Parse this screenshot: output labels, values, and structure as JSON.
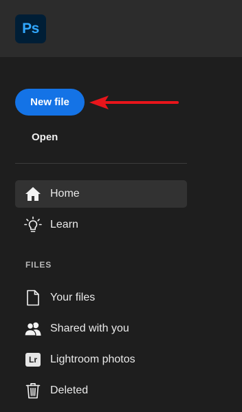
{
  "app": {
    "logo_text": "Ps",
    "logo_bg": "#001e36",
    "logo_fg": "#31a8ff"
  },
  "actions": {
    "new_file_label": "New file",
    "open_label": "Open",
    "accent_color": "#1473e6",
    "annotation_arrow_color": "#e8151b"
  },
  "nav": {
    "items": [
      {
        "label": "Home",
        "icon": "home-icon",
        "active": true
      },
      {
        "label": "Learn",
        "icon": "lightbulb-icon",
        "active": false
      }
    ]
  },
  "files": {
    "section_label": "FILES",
    "items": [
      {
        "label": "Your files",
        "icon": "document-icon"
      },
      {
        "label": "Shared with you",
        "icon": "users-icon"
      },
      {
        "label": "Lightroom photos",
        "icon": "lightroom-icon",
        "badge": "Lr"
      },
      {
        "label": "Deleted",
        "icon": "trash-icon"
      }
    ]
  }
}
